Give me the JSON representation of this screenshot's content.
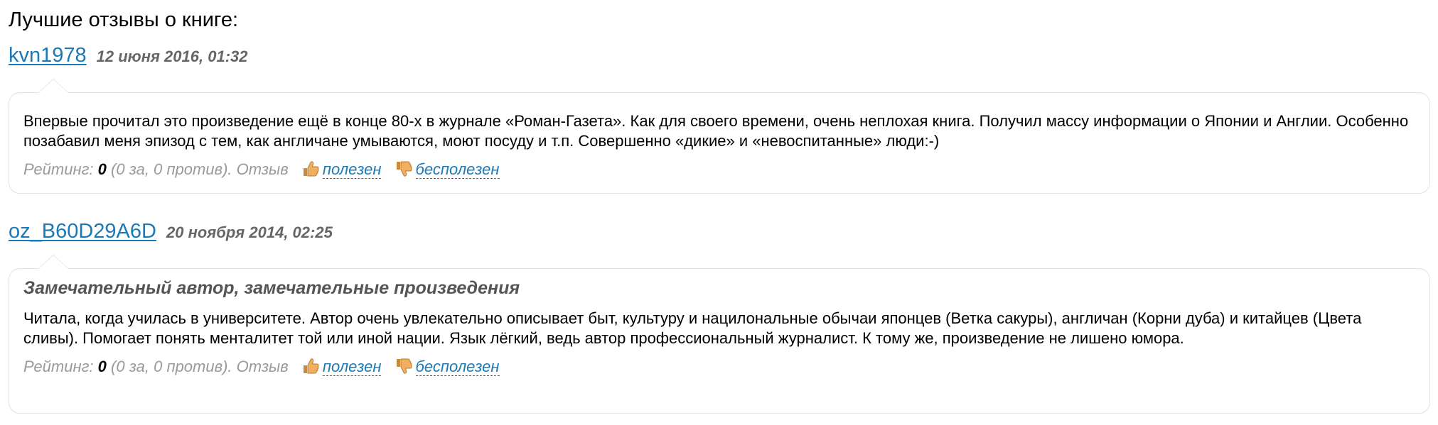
{
  "section_title": "Лучшие отзывы о книге:",
  "reviews": [
    {
      "author": "kvn1978",
      "date": "12 июня 2016, 01:32",
      "title": "",
      "text": "Впервые прочитал это произведение ещё в конце 80-х в журнале «Роман-Газета». Как для своего времени, очень неплохая книга. Получил массу информации о Японии и Англии. Особенно позабавил меня эпизод с тем, как англичане умываются, моют посуду и т.п. Совершенно «дикие» и «невоспитанные» люди:-)",
      "rating_prefix": "Рейтинг: ",
      "rating_value": "0",
      "rating_suffix": " (0 за, 0 против). Отзыв ",
      "useful_label": "полезен",
      "useless_label": "бесполезен"
    },
    {
      "author": "oz_B60D29A6D",
      "date": "20 ноября 2014, 02:25",
      "title": "Замечательный автор, замечательные произведения",
      "text": "Читала, когда училась в университете. Автор очень увлекательно описывает быт, культуру и нацилональные обычаи японцев (Ветка сакуры), англичан (Корни дуба) и китайцев (Цвета сливы). Помогает понять менталитет той или иной нации. Язык лёгкий, ведь автор профессиональный журналист. К тому же, произведение не лишено юмора.",
      "rating_prefix": "Рейтинг: ",
      "rating_value": "0",
      "rating_suffix": " (0 за, 0 против). Отзыв ",
      "useful_label": "полезен",
      "useless_label": "бесполезен"
    }
  ],
  "icons": {
    "thumb_up": "thumbs-up-icon",
    "thumb_down": "thumbs-down-icon"
  },
  "colors": {
    "link": "#1a7ab8",
    "muted": "#9a9a9a",
    "date": "#666666",
    "border": "#e2e2e2",
    "thumb": "#e0a860"
  }
}
